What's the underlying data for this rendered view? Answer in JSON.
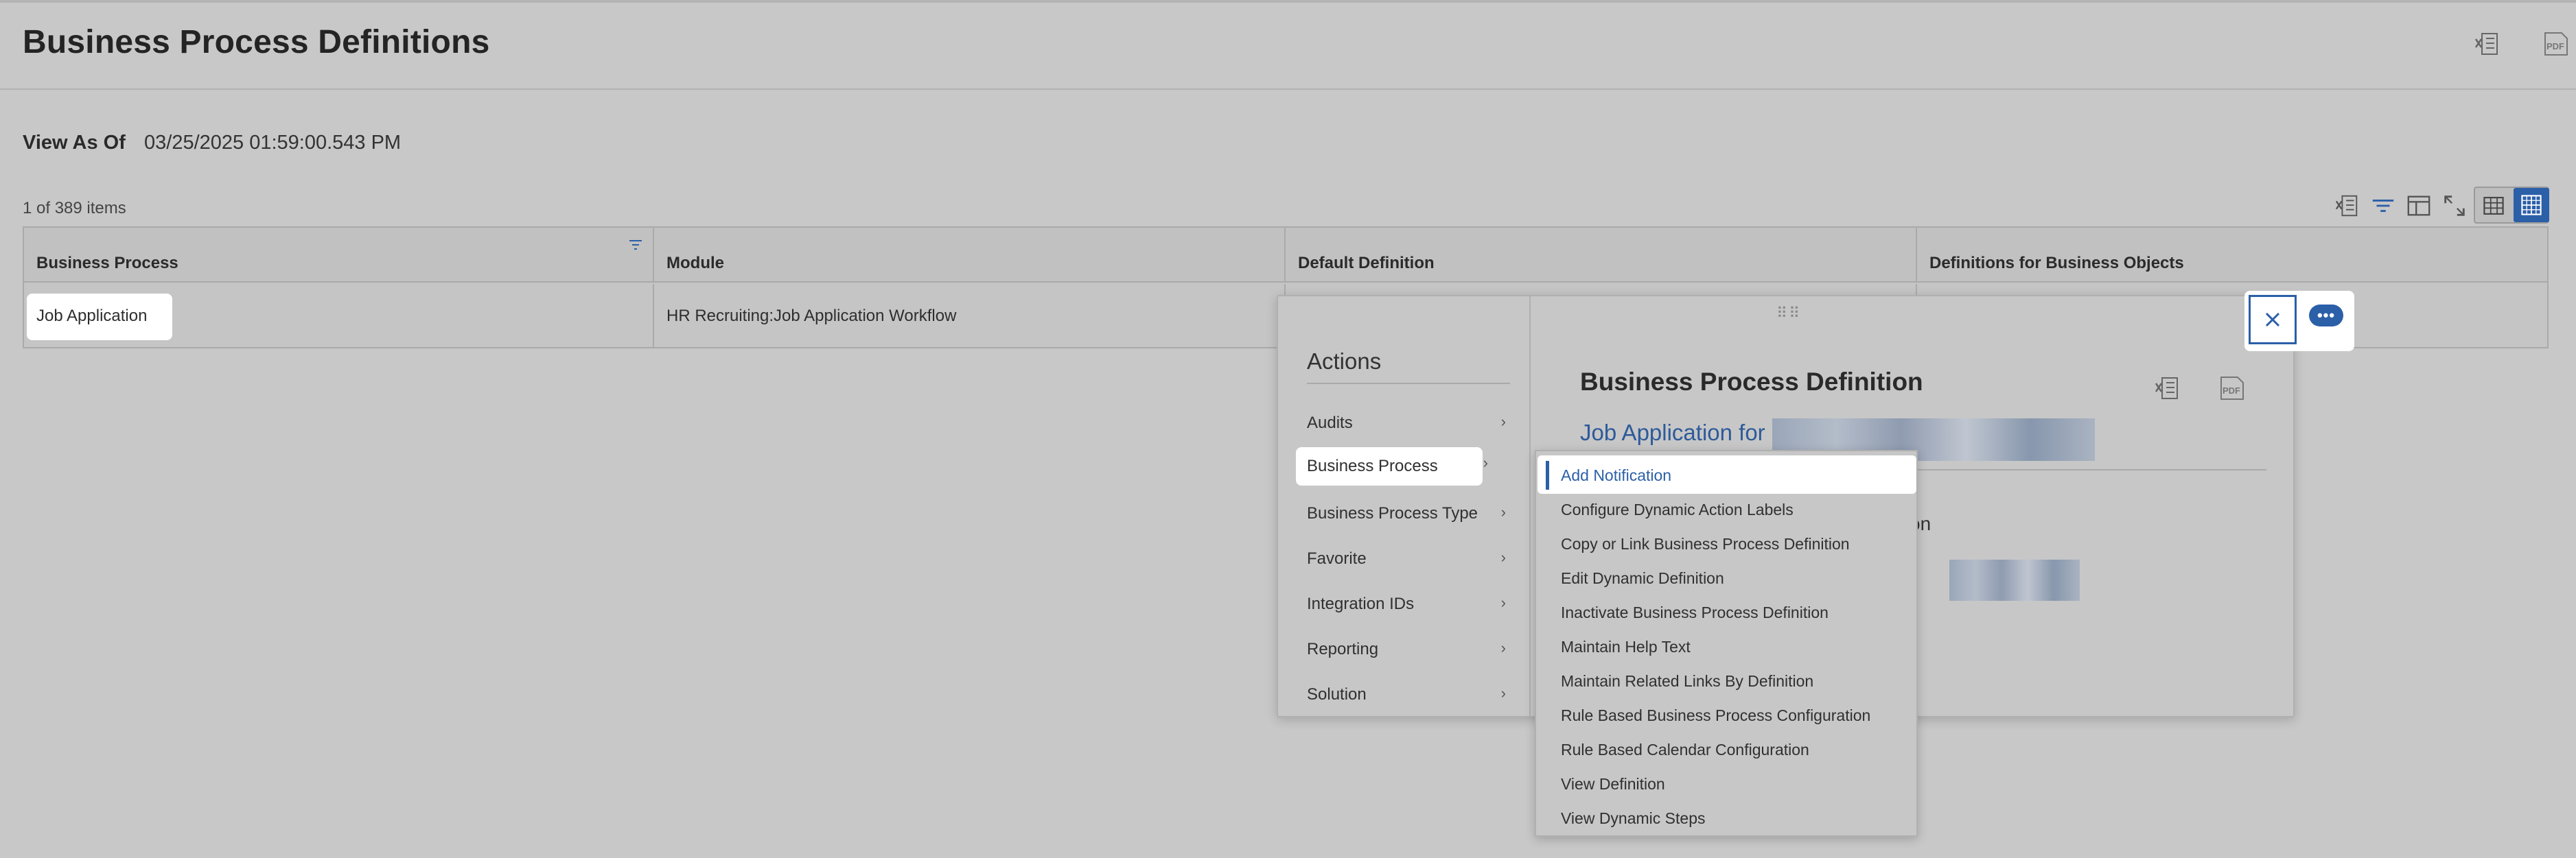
{
  "page": {
    "title": "Business Process Definitions",
    "view_as_of_label": "View As Of",
    "view_as_of_value": "03/25/2025 01:59:00.543 PM",
    "items_count": "1 of 389 items",
    "pdf_label": "PDF"
  },
  "table": {
    "columns": [
      "Business Process",
      "Module",
      "Default Definition",
      "Definitions for Business Objects"
    ],
    "rows": [
      {
        "business_process": "Job Application",
        "module": "HR Recruiting:Job Application Workflow"
      }
    ]
  },
  "actions_menu": {
    "title": "Actions",
    "items": [
      "Audits",
      "Business Process",
      "Business Process Type",
      "Favorite",
      "Integration IDs",
      "Reporting",
      "Solution"
    ],
    "selected": "Business Process"
  },
  "related_panel": {
    "title": "Business Process Definition",
    "link_text": "Job Application for",
    "partial_text_1": "on",
    "partial_text_2": "ition",
    "pdf_label": "PDF"
  },
  "submenu": {
    "items": [
      "Add Notification",
      "Configure Dynamic Action Labels",
      "Copy or Link Business Process Definition",
      "Edit Dynamic Definition",
      "Inactivate Business Process Definition",
      "Maintain Help Text",
      "Maintain Related Links By Definition",
      "Rule Based Business Process Configuration",
      "Rule Based Calendar Configuration",
      "View Definition",
      "View Dynamic Steps"
    ],
    "selected": "Add Notification"
  },
  "colors": {
    "accent": "#2b5fa8",
    "link": "#2d5a99",
    "background": "#c8c8c8"
  }
}
